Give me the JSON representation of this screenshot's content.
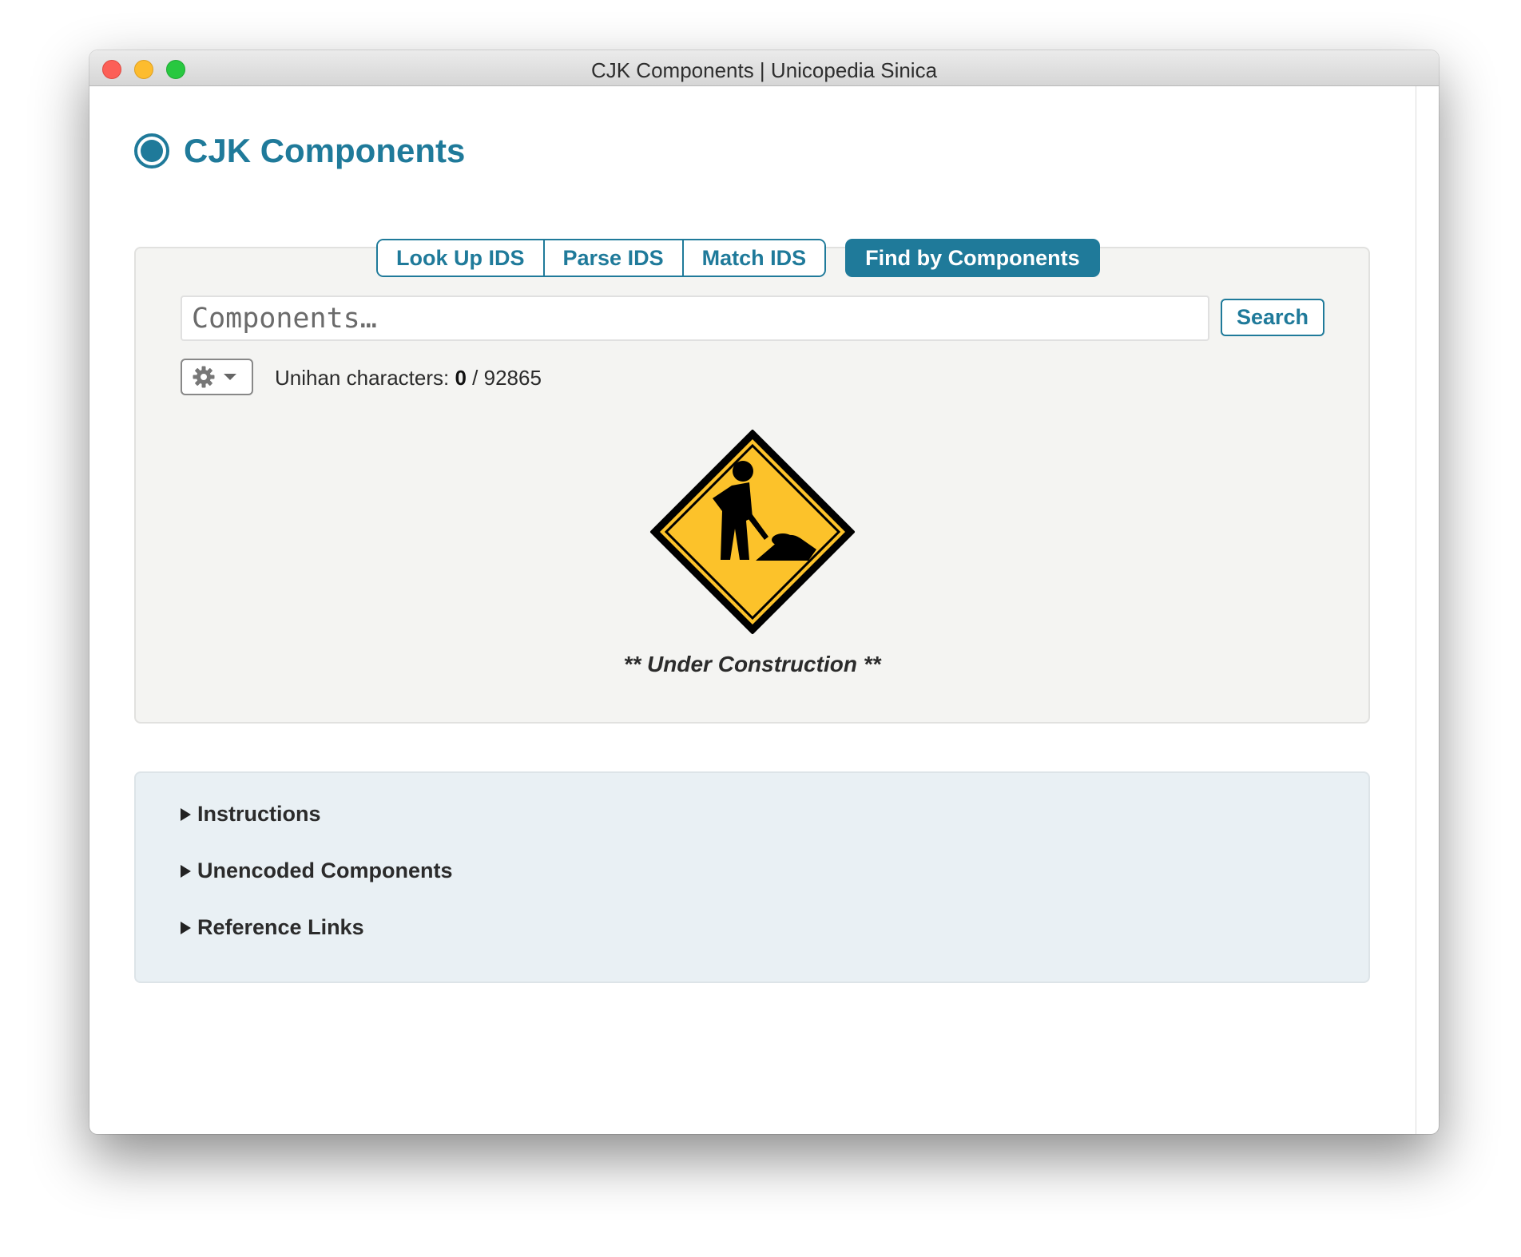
{
  "window": {
    "title": "CJK Components | Unicopedia Sinica"
  },
  "header": {
    "app_title": "CJK Components",
    "logo_icon": "radio-circle-icon"
  },
  "tabs": [
    {
      "label": "Look Up IDS",
      "active": false
    },
    {
      "label": "Parse IDS",
      "active": false
    },
    {
      "label": "Match IDS",
      "active": false
    },
    {
      "label": "Find by Components",
      "active": true
    }
  ],
  "search": {
    "placeholder": "Components…",
    "value": "",
    "button_label": "Search"
  },
  "settings": {
    "icon": "gear-icon",
    "caret_icon": "caret-down-icon"
  },
  "unihan": {
    "label": "Unihan characters:",
    "count": "0",
    "separator": "/",
    "total": "92865"
  },
  "construction": {
    "icon": "road-work-sign-icon",
    "text": "** Under Construction **"
  },
  "sections": [
    {
      "label": "Instructions"
    },
    {
      "label": "Unencoded Components"
    },
    {
      "label": "Reference Links"
    }
  ],
  "colors": {
    "accent": "#1f7a9a",
    "sign_yellow": "#fcc22a",
    "panel_bg": "#f4f4f2",
    "info_bg": "#e9f0f4"
  }
}
